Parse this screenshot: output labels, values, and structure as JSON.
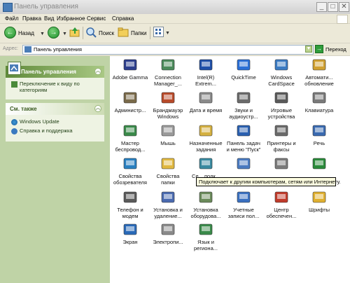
{
  "window": {
    "title": "Панель управления"
  },
  "menu": [
    "Файл",
    "Правка",
    "Вид",
    "Избранное",
    "Сервис",
    "Справка"
  ],
  "toolbar": {
    "back": "Назад",
    "search": "Поиск",
    "folders": "Папки"
  },
  "address": {
    "label": "Адрес:",
    "value": "Панель управления",
    "go": "Переход"
  },
  "sidebar": {
    "control_panel_title": "Панель управления",
    "switch_view": "Переключение к виду по категориям",
    "see_also_title": "См. также",
    "links": [
      "Windows Update",
      "Справка и поддержка"
    ]
  },
  "items": [
    {
      "label": "Adobe Gamma",
      "icon": "monitor-icon",
      "color": "#2c3e8c"
    },
    {
      "label": "Connection Manager_...",
      "icon": "phone-icon",
      "color": "#4a8a5a"
    },
    {
      "label": "Intel(R) Extrem...",
      "icon": "graphics-icon",
      "color": "#1f4fa8"
    },
    {
      "label": "QuickTime",
      "icon": "quicktime-icon",
      "color": "#2a6fd6"
    },
    {
      "label": "Windows CardSpace",
      "icon": "cardspace-icon",
      "color": "#3a7ac2"
    },
    {
      "label": "Автомати... обновление",
      "icon": "autoupdate-icon",
      "color": "#d0a030"
    },
    {
      "label": "Администр...",
      "icon": "admin-tools-icon",
      "color": "#7a6a4a"
    },
    {
      "label": "Брандмауэр Windows",
      "icon": "firewall-icon",
      "color": "#b84a2a"
    },
    {
      "label": "Дата и время",
      "icon": "clock-icon",
      "color": "#8a8a8a"
    },
    {
      "label": "Звуки и аудиоустр...",
      "icon": "speaker-icon",
      "color": "#6a6a6a"
    },
    {
      "label": "Игровые устройства",
      "icon": "joystick-icon",
      "color": "#5a5a5a"
    },
    {
      "label": "Клавиатура",
      "icon": "keyboard-icon",
      "color": "#7a7a7a"
    },
    {
      "label": "Мастер беспровод...",
      "icon": "wireless-icon",
      "color": "#3a8a4a"
    },
    {
      "label": "Мышь",
      "icon": "mouse-icon",
      "color": "#9a9a9a"
    },
    {
      "label": "Назначенные задания",
      "icon": "scheduled-tasks-icon",
      "color": "#d4b040"
    },
    {
      "label": "Панель задач и меню \"Пуск\"",
      "icon": "taskbar-icon",
      "color": "#2a60b0"
    },
    {
      "label": "Принтеры и факсы",
      "icon": "printer-icon",
      "color": "#6a6a6a"
    },
    {
      "label": "Речь",
      "icon": "speech-icon",
      "color": "#3a6ab0"
    },
    {
      "label": "Свойства обозревателя",
      "icon": "internet-options-icon",
      "color": "#2a80c0"
    },
    {
      "label": "Свойства папки",
      "icon": "folder-options-icon",
      "color": "#e0b840"
    },
    {
      "label": "Се... подк...",
      "icon": "network-icon",
      "color": "#3a8aa0"
    },
    {
      "label": "",
      "icon": "user-icon",
      "color": "#4a7ac0"
    },
    {
      "label": "",
      "icon": "system-icon",
      "color": "#7a7a7a"
    },
    {
      "label": "",
      "icon": "accessibility-icon",
      "color": "#2a8a3a"
    },
    {
      "label": "Телефон и модем",
      "icon": "phone-modem-icon",
      "color": "#5a5a5a"
    },
    {
      "label": "Установка и удаление...",
      "icon": "add-remove-icon",
      "color": "#4a6ab0"
    },
    {
      "label": "Установка оборудова...",
      "icon": "add-hardware-icon",
      "color": "#6a8a5a"
    },
    {
      "label": "Учетные записи пол...",
      "icon": "user-accounts-icon",
      "color": "#3a70c0"
    },
    {
      "label": "Центр обеспечен...",
      "icon": "security-center-icon",
      "color": "#c03a2a"
    },
    {
      "label": "Шрифты",
      "icon": "fonts-icon",
      "color": "#e0b030"
    },
    {
      "label": "Экран",
      "icon": "display-icon",
      "color": "#2a6ab8"
    },
    {
      "label": "Электропи...",
      "icon": "power-icon",
      "color": "#8a8a8a"
    },
    {
      "label": "Язык и региона...",
      "icon": "regional-icon",
      "color": "#3a8a4a"
    }
  ],
  "tooltip": "Подключает к другим компьютерам, сетям или Интернету."
}
